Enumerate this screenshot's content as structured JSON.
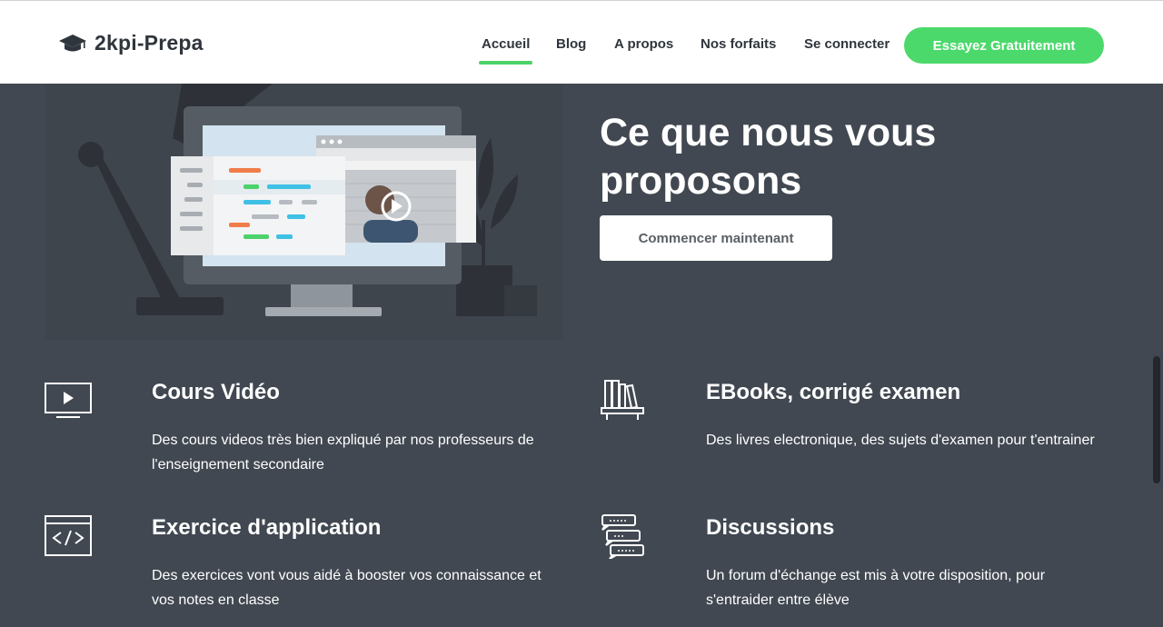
{
  "brand": {
    "name": "2kpi-Prepa",
    "icon": "graduation-cap-icon"
  },
  "nav": {
    "items": [
      {
        "label": "Accueil",
        "active": true
      },
      {
        "label": "Blog"
      },
      {
        "label": "A propos"
      },
      {
        "label": "Nos forfaits"
      },
      {
        "label": "Se connecter"
      }
    ],
    "cta": "Essayez Gratuitement"
  },
  "hero": {
    "title": "Ce que nous vous proposons",
    "button": "Commencer maintenant"
  },
  "features": [
    {
      "icon": "video-screen-icon",
      "title": "Cours Vidéo",
      "description": "Des cours videos très bien expliqué par nos professeurs de l'enseignement secondaire"
    },
    {
      "icon": "bookshelf-icon",
      "title": "EBooks, corrigé examen",
      "description": "Des livres electronique, des sujets d'examen pour t'entrainer"
    },
    {
      "icon": "code-window-icon",
      "title": "Exercice d'application",
      "description": "Des exercices vont vous aidé à booster vos connaissance et vos notes en classe"
    },
    {
      "icon": "chat-bubbles-icon",
      "title": "Discussions",
      "description": "Un forum d'échange est mis à votre disposition, pour s'entraider entre élève"
    }
  ],
  "colors": {
    "accent": "#4cd96c",
    "background": "#414851",
    "header": "#ffffff"
  }
}
